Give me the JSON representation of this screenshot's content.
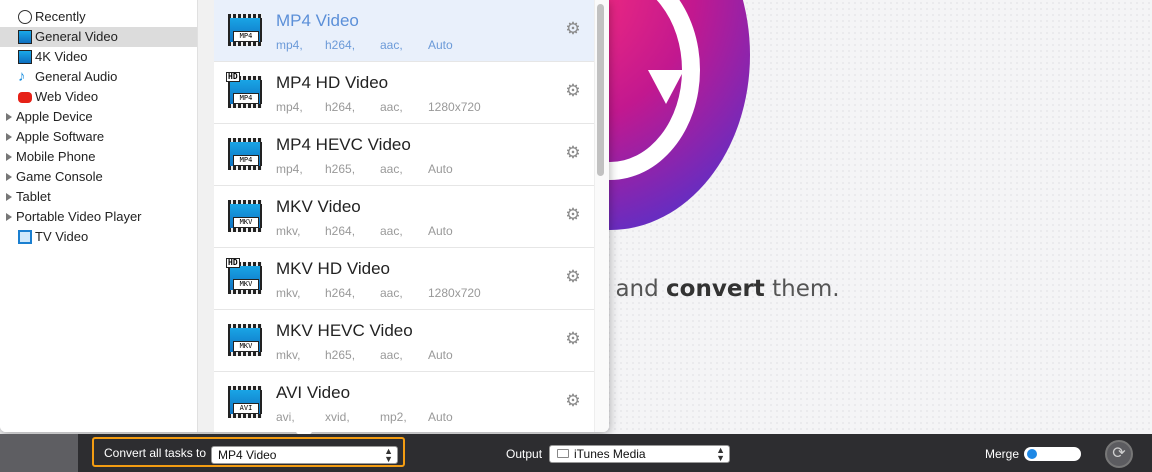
{
  "sidebar": {
    "items": [
      {
        "label": "Recently",
        "icon": "clock-icon",
        "expandable": false,
        "selected": false
      },
      {
        "label": "General Video",
        "icon": "film-icon",
        "expandable": false,
        "selected": true
      },
      {
        "label": "4K Video",
        "icon": "4k-film-icon",
        "expandable": false,
        "selected": false
      },
      {
        "label": "General Audio",
        "icon": "music-note-icon",
        "expandable": false,
        "selected": false
      },
      {
        "label": "Web Video",
        "icon": "youtube-icon",
        "expandable": false,
        "selected": false
      },
      {
        "label": "Apple Device",
        "icon": "disclosure-triangle-icon",
        "expandable": true,
        "selected": false
      },
      {
        "label": "Apple Software",
        "icon": "disclosure-triangle-icon",
        "expandable": true,
        "selected": false
      },
      {
        "label": "Mobile Phone",
        "icon": "disclosure-triangle-icon",
        "expandable": true,
        "selected": false
      },
      {
        "label": "Game Console",
        "icon": "disclosure-triangle-icon",
        "expandable": true,
        "selected": false
      },
      {
        "label": "Tablet",
        "icon": "disclosure-triangle-icon",
        "expandable": true,
        "selected": false
      },
      {
        "label": "Portable Video Player",
        "icon": "disclosure-triangle-icon",
        "expandable": true,
        "selected": false
      },
      {
        "label": "TV Video",
        "icon": "tv-icon",
        "expandable": false,
        "selected": false
      }
    ]
  },
  "formats": [
    {
      "title": "MP4 Video",
      "badge": "MP4",
      "hd": false,
      "specs": [
        "mp4,",
        "h264,",
        "aac,",
        "Auto"
      ],
      "selected": true
    },
    {
      "title": "MP4 HD Video",
      "badge": "MP4",
      "hd": true,
      "specs": [
        "mp4,",
        "h264,",
        "aac,",
        "1280x720"
      ],
      "selected": false
    },
    {
      "title": "MP4 HEVC Video",
      "badge": "MP4",
      "hd": false,
      "specs": [
        "mp4,",
        "h265,",
        "aac,",
        "Auto"
      ],
      "selected": false
    },
    {
      "title": "MKV Video",
      "badge": "MKV",
      "hd": false,
      "specs": [
        "mkv,",
        "h264,",
        "aac,",
        "Auto"
      ],
      "selected": false
    },
    {
      "title": "MKV HD Video",
      "badge": "MKV",
      "hd": true,
      "specs": [
        "mkv,",
        "h264,",
        "aac,",
        "1280x720"
      ],
      "selected": false
    },
    {
      "title": "MKV HEVC Video",
      "badge": "MKV",
      "hd": false,
      "specs": [
        "mkv,",
        "h265,",
        "aac,",
        "Auto"
      ],
      "selected": false
    },
    {
      "title": "AVI Video",
      "badge": "AVI",
      "hd": false,
      "specs": [
        "avi,",
        "xvid,",
        "mp2,",
        "Auto"
      ],
      "selected": false
    }
  ],
  "hd_badge": "HD",
  "background": {
    "tagline_before": "e and ",
    "tagline_bold": "convert",
    "tagline_after": " them."
  },
  "bottombar": {
    "convert_label": "Convert all tasks to",
    "convert_value": "MP4 Video",
    "output_label": "Output",
    "output_value": "iTunes Media",
    "merge_label": "Merge",
    "merge_on": false
  },
  "colors": {
    "accent_orange": "#f39c12",
    "selected_blue": "#5b8fd8",
    "toggle_blue": "#1e88e5"
  }
}
